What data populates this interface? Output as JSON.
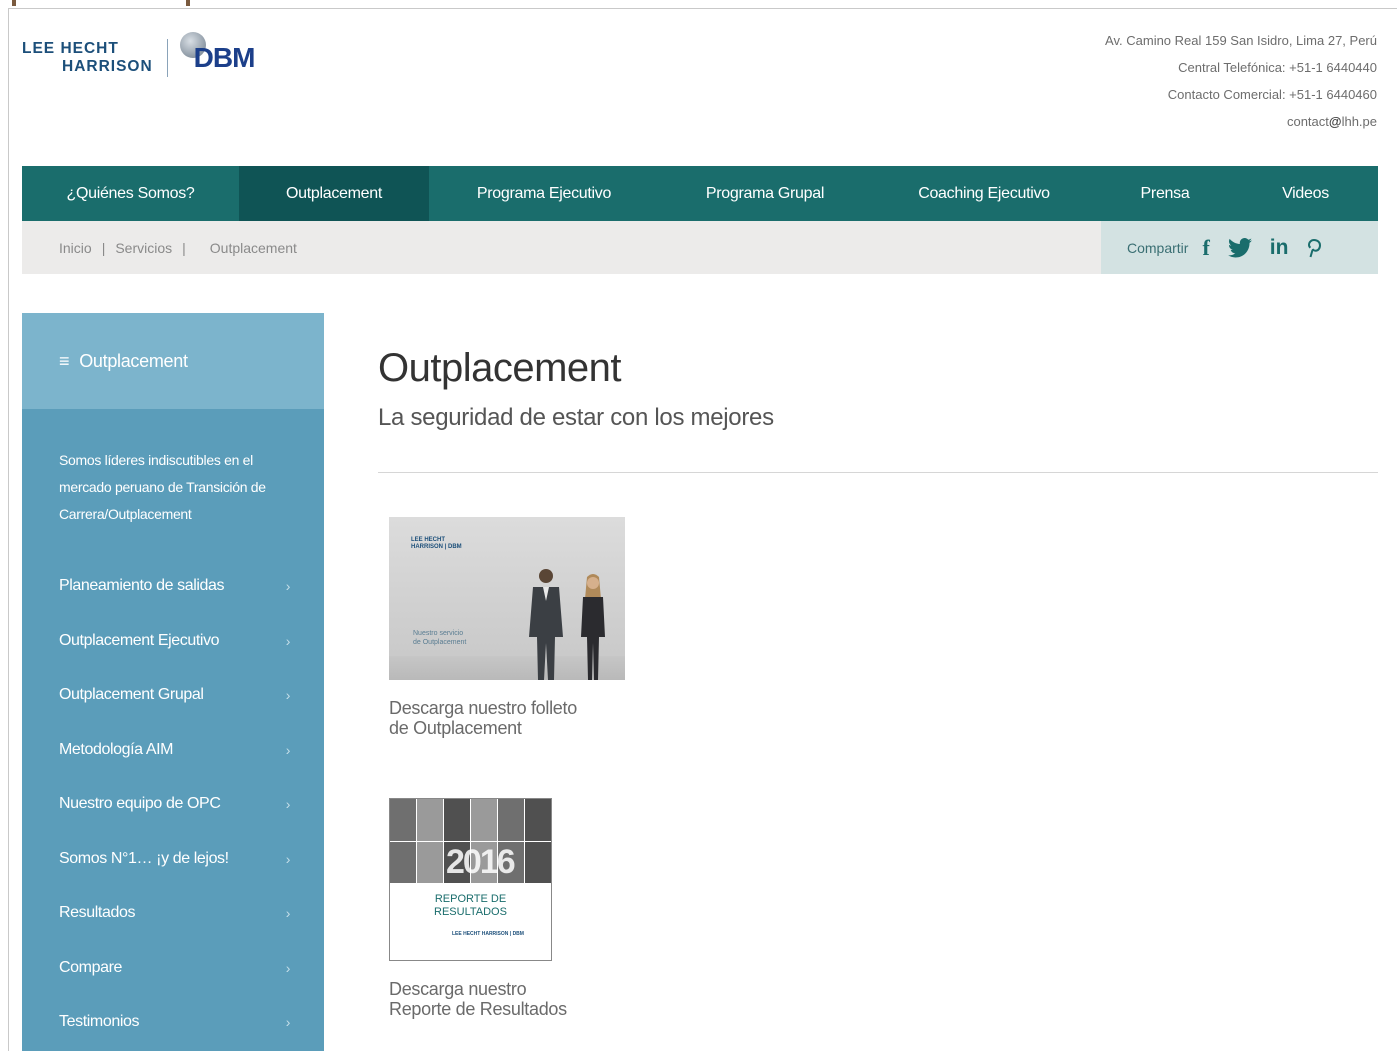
{
  "header": {
    "logo_lhh_line1": "LEE HECHT",
    "logo_lhh_line2": "HARRISON",
    "logo_dbm": "DBM",
    "contact": {
      "address": "Av. Camino Real 159 San Isidro, Lima 27, Perú",
      "phone_central": "Central Telefónica: +51-1 6440440",
      "phone_commercial": "Contacto Comercial: +51-1 6440460",
      "email_user": "contact",
      "email_at": "@",
      "email_domain": "lhh.pe"
    }
  },
  "nav": {
    "items": [
      {
        "label": "¿Quiénes Somos?"
      },
      {
        "label": "Outplacement"
      },
      {
        "label": "Programa Ejecutivo"
      },
      {
        "label": "Programa Grupal"
      },
      {
        "label": "Coaching Ejecutivo"
      },
      {
        "label": "Prensa"
      },
      {
        "label": "Videos"
      }
    ],
    "active_index": 1
  },
  "breadcrumb": {
    "items": [
      "Inicio",
      "Servicios",
      "Outplacement"
    ],
    "separator": "|"
  },
  "share": {
    "label": "Compartir",
    "icons": [
      "facebook-icon",
      "twitter-icon",
      "linkedin-icon",
      "pinterest-icon"
    ],
    "fb_glyph": "f",
    "li_glyph": "in"
  },
  "sidebar": {
    "menu_glyph": "≡",
    "title": "Outplacement",
    "intro": "Somos líderes indiscutibles en el mercado peruano de Transición de Carrera/Outplacement",
    "chevron": "›",
    "items": [
      {
        "label": "Planeamiento de salidas"
      },
      {
        "label": "Outplacement Ejecutivo"
      },
      {
        "label": "Outplacement Grupal"
      },
      {
        "label": "Metodología AIM"
      },
      {
        "label": "Nuestro equipo de OPC"
      },
      {
        "label": "Somos N°1… ¡y de lejos!"
      },
      {
        "label": "Resultados"
      },
      {
        "label": "Compare"
      },
      {
        "label": "Testimonios"
      }
    ]
  },
  "main": {
    "title": "Outplacement",
    "subtitle": "La seguridad de estar con los mejores",
    "downloads": [
      {
        "caption_line1": "Descarga nuestro folleto",
        "caption_line2": "de Outplacement",
        "thumb_logo_line1": "LEE HECHT",
        "thumb_logo_line2": "HARRISON | DBM",
        "thumb_text_line1": "Nuestro servicio",
        "thumb_text_line2": "de Outplacement"
      },
      {
        "caption_line1": "Descarga nuestro",
        "caption_line2": "Reporte de Resultados",
        "thumb_year": "2016",
        "thumb_title_line1": "REPORTE DE",
        "thumb_title_line2": "RESULTADOS",
        "thumb_logo": "LEE HECHT HARRISON | DBM"
      }
    ]
  },
  "colors": {
    "nav_bg": "#1a6d6c",
    "nav_active": "#0f5455",
    "sidebar_bg": "#5b9dba",
    "sidebar_head": "#7cb4cc",
    "crumb_bg": "#ecebea",
    "share_bg": "#d3e2e2"
  }
}
